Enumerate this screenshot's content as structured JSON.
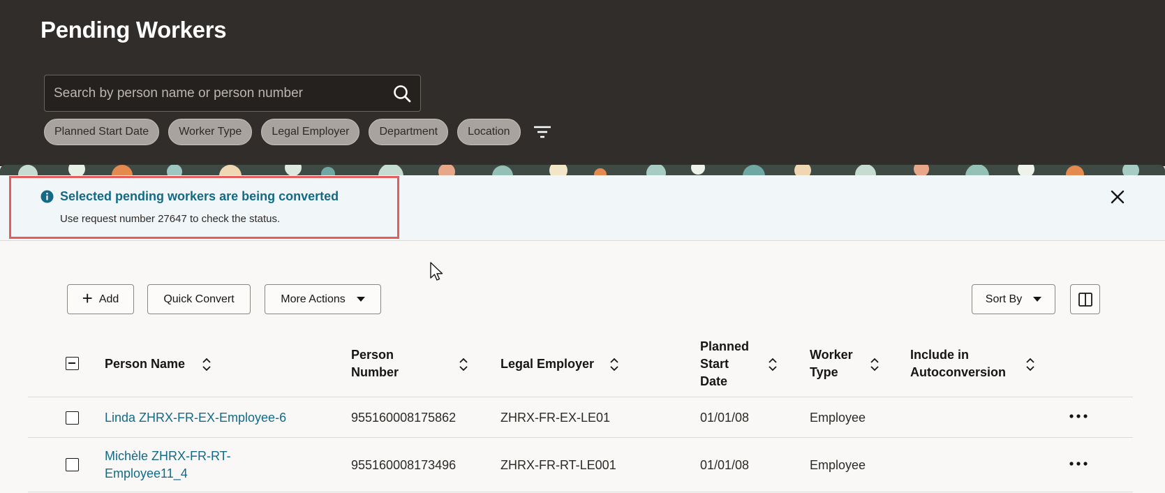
{
  "header": {
    "title": "Pending Workers",
    "search_placeholder": "Search by person name or person number",
    "filter_chips": [
      "Planned Start Date",
      "Worker Type",
      "Legal Employer",
      "Department",
      "Location"
    ]
  },
  "message": {
    "title": "Selected pending workers are being converted",
    "body": "Use request number 27647 to check the status."
  },
  "toolbar": {
    "add_label": "Add",
    "quick_convert_label": "Quick Convert",
    "more_actions_label": "More Actions",
    "sort_label": "Sort By"
  },
  "table": {
    "columns": {
      "person_name": "Person Name",
      "person_number_1": "Person",
      "person_number_2": "Number",
      "legal_employer": "Legal Employer",
      "planned_start_1": "Planned",
      "planned_start_2": "Start",
      "planned_start_3": "Date",
      "worker_type_1": "Worker",
      "worker_type_2": "Type",
      "autoconversion_1": "Include in",
      "autoconversion_2": "Autoconversion"
    },
    "rows": [
      {
        "name_line1": "Linda ZHRX-FR-EX-Employee-6",
        "name_line2": "",
        "person_number": "955160008175862",
        "legal_employer": "ZHRX-FR-EX-LE01",
        "planned_start": "01/01/08",
        "worker_type": "Employee"
      },
      {
        "name_line1": "Michèle ZHRX-FR-RT-",
        "name_line2": "Employee11_4",
        "person_number": "955160008173496",
        "legal_employer": "ZHRX-FR-RT-LE001",
        "planned_start": "01/01/08",
        "worker_type": "Employee"
      }
    ]
  },
  "colors": {
    "header_bg": "#312d2a",
    "link": "#126a86",
    "message_bg": "#f1f6f9",
    "highlight_outline": "#e45c5c"
  }
}
